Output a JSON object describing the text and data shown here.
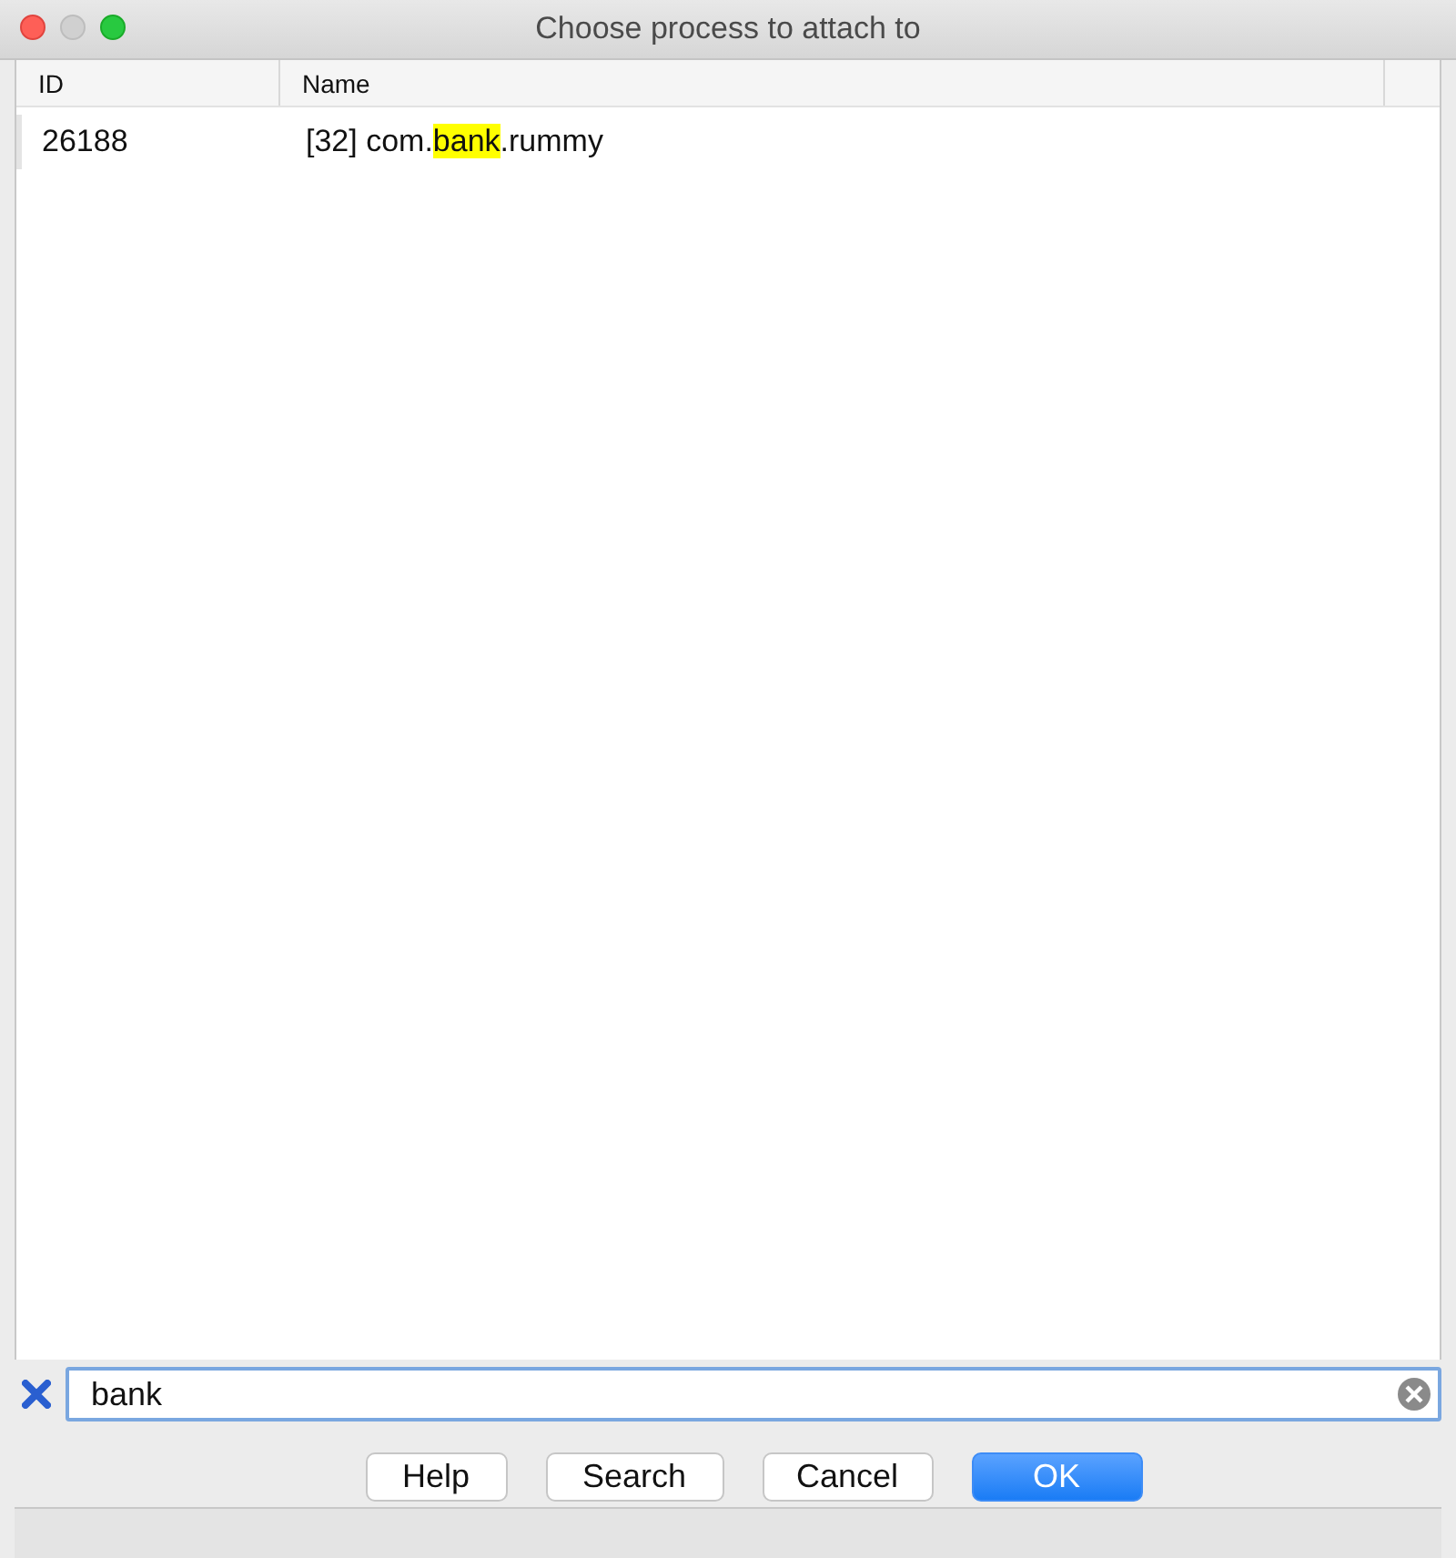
{
  "window": {
    "title": "Choose process to attach to"
  },
  "table": {
    "columns": [
      "ID",
      "Name"
    ],
    "rows": [
      {
        "id": "26188",
        "name": [
          {
            "text": "[32] com.",
            "highlighted": false
          },
          {
            "text": "bank",
            "highlighted": true
          },
          {
            "text": ".rummy",
            "highlighted": false
          }
        ]
      }
    ]
  },
  "filter": {
    "value": "bank"
  },
  "buttons": [
    {
      "label": "Help",
      "default": false
    },
    {
      "label": "Search",
      "default": false
    },
    {
      "label": "Cancel",
      "default": false
    },
    {
      "label": "OK",
      "default": true
    }
  ]
}
